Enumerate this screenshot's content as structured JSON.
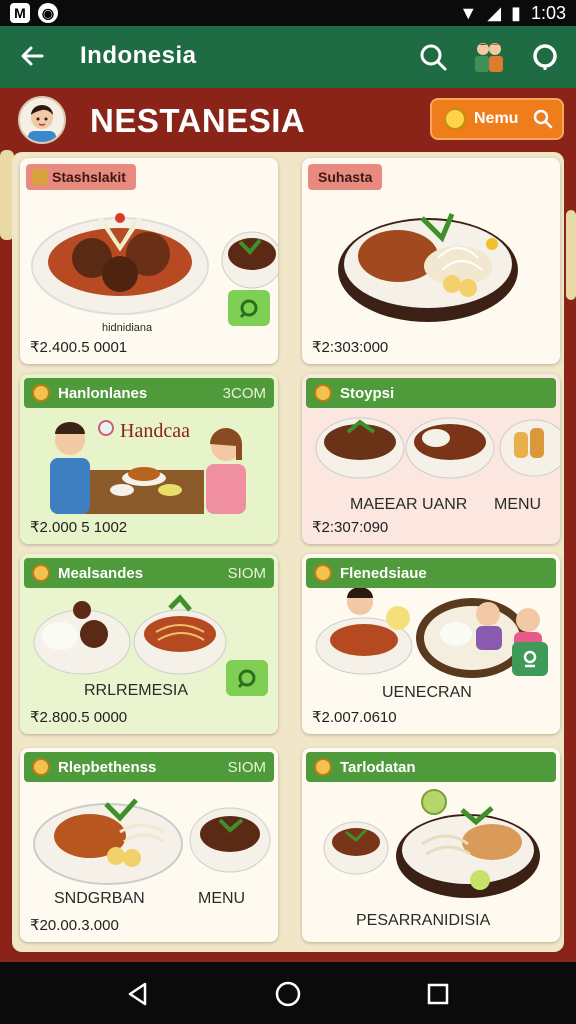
{
  "status_bar": {
    "time": "1:03"
  },
  "app_bar": {
    "title": "Indonesia"
  },
  "header": {
    "brand": "NESTANESIA",
    "menu_button_label": "Nemu"
  },
  "cards": [
    {
      "title": "Stashslakit",
      "caption": "hidnidiana",
      "price": "₹2.400.5 0001"
    },
    {
      "title": "Suhasta",
      "price": "₹2:303:000"
    },
    {
      "title": "Hanlonlanes",
      "badge": "3COM",
      "caption": "Handcaa",
      "price": "₹2.000 5 1002"
    },
    {
      "title": "Stoypsi",
      "caption_left": "MAEEAR UANR",
      "caption_right": "MENU",
      "price": "₹2:307:090"
    },
    {
      "title": "Mealsandes",
      "badge": "SIOM",
      "caption": "RRLREMESIA",
      "price": "₹2.800.5 0000"
    },
    {
      "title": "Flenedsiaue",
      "caption": "UENECRAN",
      "price": "₹2.007.0610"
    },
    {
      "title": "Rlepbethenss",
      "badge": "SIOM",
      "caption_left": "SNDGRBAN",
      "caption_right": "MENU",
      "price": "₹20.00.3.000"
    },
    {
      "title": "Tarlodatan",
      "caption": "PESARRANIDISIA"
    }
  ],
  "colors": {
    "background": "#8a2418",
    "app_bar": "#1f6b44",
    "menu_button": "#ef7d1c",
    "card_header_green": "#4f9a3a",
    "card_tag_pink": "#e88a7f"
  },
  "icons": [
    "back-arrow-icon",
    "search-icon",
    "family-icon",
    "location-icon",
    "coin-icon",
    "menu-search-icon"
  ]
}
